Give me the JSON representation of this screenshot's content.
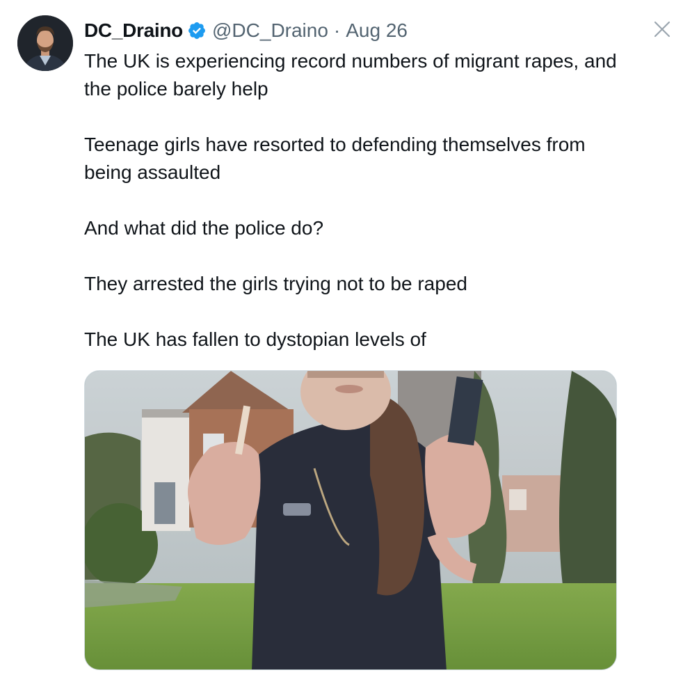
{
  "tweet": {
    "author": {
      "display_name": "DC_Draino",
      "handle": "@DC_Draino",
      "verified": true,
      "avatar_icon": "profile-photo"
    },
    "separator": "·",
    "date": "Aug 26",
    "paragraphs": [
      "The UK is experiencing record numbers of migrant rapes, and the police barely help",
      "Teenage girls have resorted to defending themselves from being assaulted",
      "And what did the police do?",
      "They arrested the girls trying not to be raped",
      "The UK has fallen to dystopian levels of"
    ],
    "media_icon": "video-thumbnail"
  },
  "controls": {
    "close_icon": "close-icon"
  },
  "colors": {
    "text_primary": "#0f1419",
    "text_secondary": "#536471",
    "verified_blue": "#1d9bf0",
    "border": "#cfd9de"
  }
}
